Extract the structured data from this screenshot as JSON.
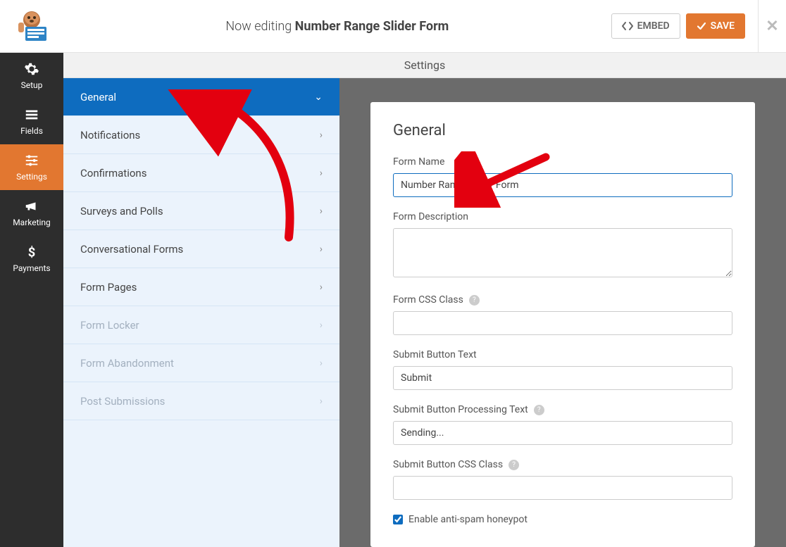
{
  "header": {
    "editing_prefix": "Now editing",
    "form_title": "Number Range Slider Form",
    "embed_label": "EMBED",
    "save_label": "SAVE"
  },
  "nav": {
    "setup": "Setup",
    "fields": "Fields",
    "settings": "Settings",
    "marketing": "Marketing",
    "payments": "Payments"
  },
  "settings_header": "Settings",
  "sections": {
    "general": "General",
    "notifications": "Notifications",
    "confirmations": "Confirmations",
    "surveys": "Surveys and Polls",
    "conversational": "Conversational Forms",
    "formpages": "Form Pages",
    "formlocker": "Form Locker",
    "abandonment": "Form Abandonment",
    "postsubmissions": "Post Submissions"
  },
  "panel": {
    "title": "General",
    "form_name_label": "Form Name",
    "form_name_value": "Number Range Slider Form",
    "form_desc_label": "Form Description",
    "form_desc_value": "",
    "css_class_label": "Form CSS Class",
    "css_class_value": "",
    "submit_text_label": "Submit Button Text",
    "submit_text_value": "Submit",
    "submit_processing_label": "Submit Button Processing Text",
    "submit_processing_value": "Sending...",
    "submit_css_label": "Submit Button CSS Class",
    "submit_css_value": "",
    "honeypot_label": "Enable anti-spam honeypot"
  }
}
